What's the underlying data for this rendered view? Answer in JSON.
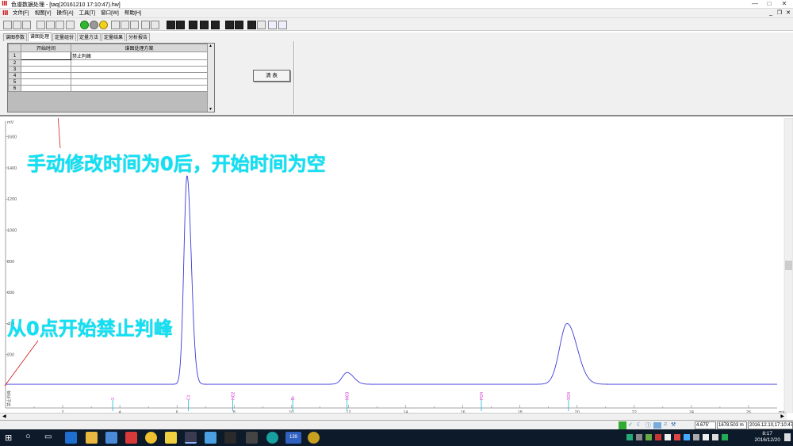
{
  "window": {
    "title": "色谱数据处理 - [taq(20161210 17:10:47).hw]",
    "minimize": "—",
    "maximize": "□",
    "close": "✕"
  },
  "menu": [
    "文件[F]",
    "视图[V]",
    "操作[A]",
    "工具[T]",
    "窗口[W]",
    "帮助[H]"
  ],
  "tabs": [
    "谱图参数",
    "谱图处理",
    "定量组份",
    "定量方法",
    "定量结果",
    "分析报告"
  ],
  "active_tab": "谱图处理",
  "grid": {
    "headers": [
      "开始时间",
      "谱图处理方案"
    ],
    "rows": [
      {
        "num": "1",
        "start": "",
        "scheme": "禁止判峰"
      },
      {
        "num": "2",
        "start": "",
        "scheme": ""
      },
      {
        "num": "3",
        "start": "",
        "scheme": ""
      },
      {
        "num": "4",
        "start": "",
        "scheme": ""
      },
      {
        "num": "5",
        "start": "",
        "scheme": ""
      },
      {
        "num": "6",
        "start": "",
        "scheme": ""
      }
    ]
  },
  "clear_button": "清  表",
  "annotations": {
    "top": "手动修改时间为0后，开始时间为空",
    "bottom": "从0点开始禁止判峰"
  },
  "chart_data": {
    "type": "line",
    "ylabel": "mV",
    "xlabel": "min",
    "xlim": [
      0,
      27
    ],
    "ylim": [
      0,
      1700
    ],
    "y_ticks": [
      200,
      400,
      600,
      800,
      1000,
      1200,
      1400,
      1600
    ],
    "x_ticks": [
      2,
      4,
      6,
      8,
      10,
      12,
      14,
      16,
      18,
      20,
      22,
      24,
      26
    ],
    "peaks": [
      {
        "rt": 6.35,
        "height": 1340,
        "sigma": 0.11
      },
      {
        "rt": 11.95,
        "height": 75,
        "sigma": 0.17
      },
      {
        "rt": 19.65,
        "height": 390,
        "sigma": 0.26
      }
    ],
    "baseline": 10,
    "peak_markers": [
      {
        "x": 3.75,
        "label": "3"
      },
      {
        "x": 6.4,
        "label": "C1"
      },
      {
        "x": 7.95,
        "label": "HO2"
      },
      {
        "x": 10.05,
        "label": "Br"
      },
      {
        "x": 11.95,
        "label": "NO3"
      },
      {
        "x": 16.65,
        "label": "PO4"
      },
      {
        "x": 19.7,
        "label": "SO4"
      }
    ],
    "event_label": "禁止判峰",
    "line_color": "#3a3ad8",
    "marker_color": "#d028d0"
  },
  "status": {
    "x_readout": "4.675'",
    "y_readout": "1678.503 m",
    "file_time": "2016.12.10,17:10:47"
  },
  "taskbar": {
    "tray_num": "139",
    "time": "8:17",
    "date": "2016/12/20"
  }
}
